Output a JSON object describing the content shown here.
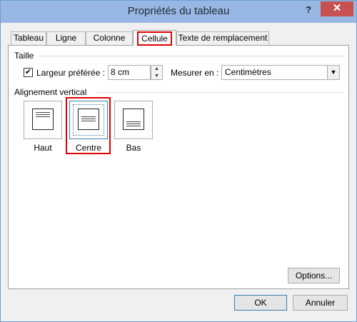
{
  "window": {
    "title": "Propriétés du tableau",
    "help": "?",
    "close": "✕"
  },
  "tabs": [
    {
      "label": "Tableau"
    },
    {
      "label": "Ligne"
    },
    {
      "label": "Colonne"
    },
    {
      "label": "Cellule"
    },
    {
      "label": "Texte de remplacement"
    }
  ],
  "active_tab": "Cellule",
  "taille": {
    "section": "Taille",
    "checkbox_checked": true,
    "preferred_width_label": "Largeur préférée :",
    "preferred_width_value": "8 cm",
    "measure_label": "Mesurer en :",
    "measure_value": "Centimètres"
  },
  "alignment": {
    "section": "Alignement vertical",
    "options": [
      {
        "label": "Haut"
      },
      {
        "label": "Centre"
      },
      {
        "label": "Bas"
      }
    ],
    "selected": "Centre"
  },
  "buttons": {
    "options": "Options...",
    "ok": "OK",
    "cancel": "Annuler"
  },
  "colors": {
    "highlight": "#e00000",
    "titlebar": "#98b8e3",
    "close": "#c75050"
  }
}
